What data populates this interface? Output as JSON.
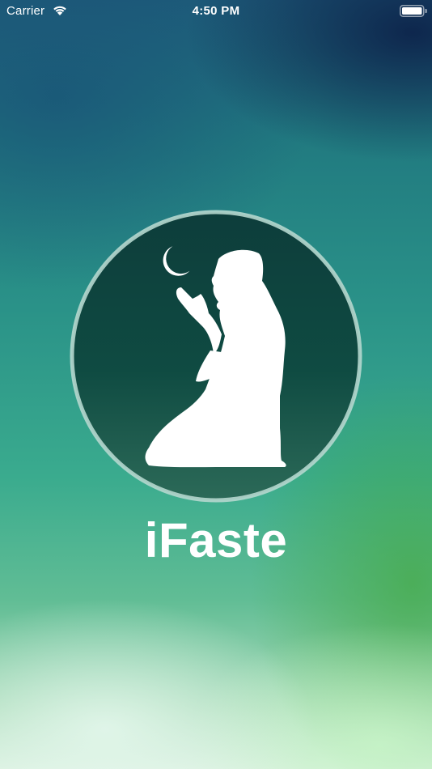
{
  "status_bar": {
    "carrier": "Carrier",
    "time": "4:50 PM",
    "wifi_icon": "wifi-icon",
    "battery_icon": "battery-full-icon"
  },
  "splash": {
    "emblem_icon": "praying-man-crescent-icon",
    "app_name": "iFaste"
  },
  "colors": {
    "emblem_fill": "#0f4d43",
    "emblem_ring": "#b5d7ce",
    "text": "#ffffff"
  }
}
